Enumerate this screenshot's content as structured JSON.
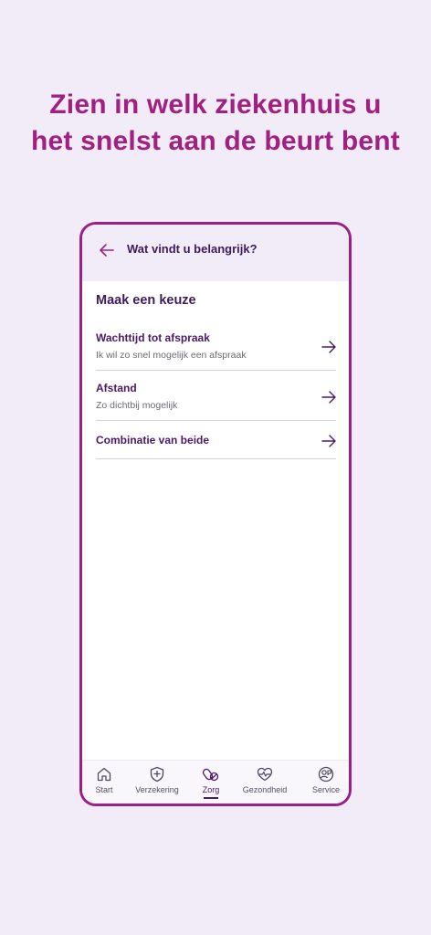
{
  "promo": {
    "line1": "Zien in welk ziekenhuis u",
    "line2": "het snelst aan de beurt bent"
  },
  "header": {
    "title": "Wat vindt u belangrijk?",
    "back_icon": "arrow-left-icon"
  },
  "section": {
    "title": "Maak een keuze"
  },
  "choices": [
    {
      "title": "Wachttijd tot afspraak",
      "subtitle": "Ik wil zo snel mogelijk een afspraak"
    },
    {
      "title": "Afstand",
      "subtitle": "Zo dichtbij mogelijk"
    },
    {
      "title": "Combinatie van beide",
      "subtitle": ""
    }
  ],
  "nav": [
    {
      "label": "Start",
      "icon": "home-icon"
    },
    {
      "label": "Verzekering",
      "icon": "shield-plus-icon"
    },
    {
      "label": "Zorg",
      "icon": "pills-icon",
      "active": true
    },
    {
      "label": "Gezondheid",
      "icon": "heart-pulse-icon"
    },
    {
      "label": "Service",
      "icon": "support-icon"
    }
  ],
  "colors": {
    "brand": "#a0217f",
    "frame": "#9a1f86",
    "primary_text": "#3d1b5c",
    "background": "#f1ecf7"
  }
}
